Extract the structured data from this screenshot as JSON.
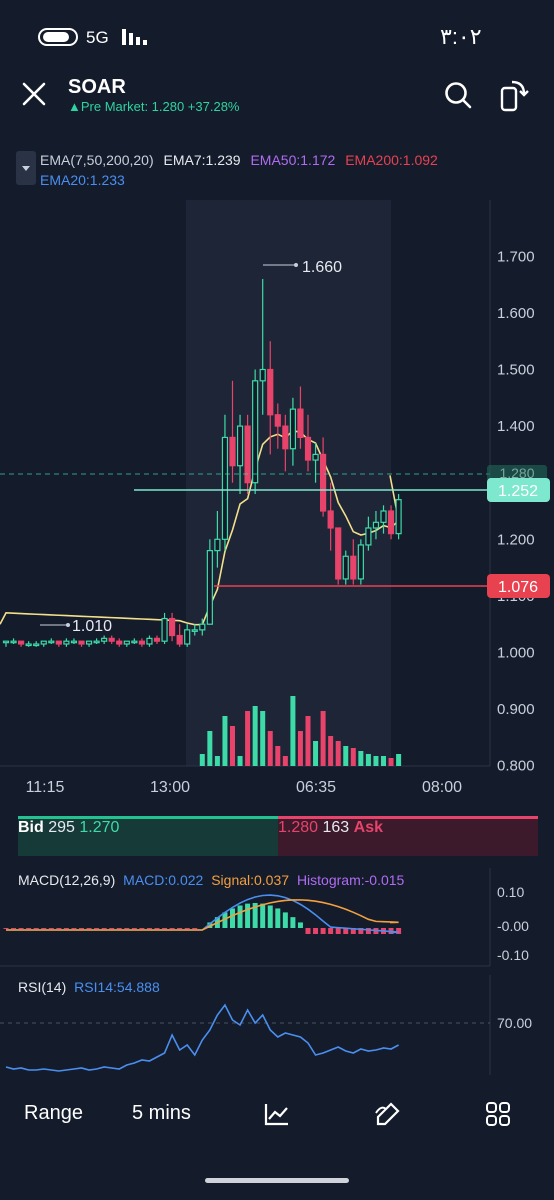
{
  "status_bar": {
    "network": "5G",
    "clock": "٣:٠٢"
  },
  "header": {
    "symbol": "SOAR",
    "pre_market": "▲Pre Market: 1.280 +37.28%"
  },
  "ema_legend": {
    "label": "EMA(7,50,200,20)",
    "ema7": "EMA7:1.239",
    "ema50": "EMA50:1.172",
    "ema200": "EMA200:1.092",
    "ema20": "EMA20:1.233"
  },
  "colors": {
    "background": "#141b2b",
    "up": "#3ddba8",
    "down": "#e8436a",
    "ema7": "#f2e08a",
    "ema50": "#b06cf2",
    "ema200": "#e84250",
    "ema20": "#4a8ff0"
  },
  "chart_data": [
    {
      "type": "candlestick",
      "y_ticks": [
        "1.700",
        "1.600",
        "1.500",
        "1.400",
        "1.300",
        "1.200",
        "1.100",
        "1.000",
        "0.900",
        "0.800"
      ],
      "ylim": [
        0.75,
        1.75
      ],
      "x_ticks": [
        "11:15",
        "13:00",
        "06:35",
        "08:00"
      ],
      "annotations": {
        "high": "1.660",
        "low": "1.010"
      },
      "price_tags": {
        "current": "1.252",
        "ema200": "1.076",
        "last_close_hidden": "1.280"
      },
      "candles": [
        [
          1.02,
          1.02,
          1.01,
          1.02
        ],
        [
          1.02,
          1.025,
          1.015,
          1.02
        ],
        [
          1.02,
          1.02,
          1.01,
          1.015
        ],
        [
          1.015,
          1.02,
          1.01,
          1.015
        ],
        [
          1.015,
          1.02,
          1.01,
          1.015
        ],
        [
          1.015,
          1.02,
          1.01,
          1.02
        ],
        [
          1.02,
          1.025,
          1.015,
          1.02
        ],
        [
          1.02,
          1.02,
          1.01,
          1.015
        ],
        [
          1.015,
          1.025,
          1.01,
          1.02
        ],
        [
          1.02,
          1.025,
          1.015,
          1.02
        ],
        [
          1.02,
          1.02,
          1.01,
          1.015
        ],
        [
          1.015,
          1.02,
          1.01,
          1.02
        ],
        [
          1.02,
          1.025,
          1.015,
          1.02
        ],
        [
          1.02,
          1.03,
          1.015,
          1.025
        ],
        [
          1.025,
          1.03,
          1.015,
          1.02
        ],
        [
          1.02,
          1.025,
          1.01,
          1.015
        ],
        [
          1.015,
          1.02,
          1.01,
          1.02
        ],
        [
          1.02,
          1.025,
          1.015,
          1.02
        ],
        [
          1.02,
          1.025,
          1.01,
          1.015
        ],
        [
          1.015,
          1.03,
          1.01,
          1.025
        ],
        [
          1.025,
          1.03,
          1.015,
          1.02
        ],
        [
          1.02,
          1.07,
          1.015,
          1.06
        ],
        [
          1.06,
          1.07,
          1.02,
          1.03
        ],
        [
          1.03,
          1.05,
          1.01,
          1.015
        ],
        [
          1.015,
          1.05,
          1.01,
          1.04
        ],
        [
          1.04,
          1.05,
          1.03,
          1.04
        ],
        [
          1.04,
          1.06,
          1.03,
          1.05
        ],
        [
          1.05,
          1.2,
          1.05,
          1.18
        ],
        [
          1.18,
          1.25,
          1.15,
          1.2
        ],
        [
          1.2,
          1.42,
          1.18,
          1.38
        ],
        [
          1.38,
          1.48,
          1.3,
          1.33
        ],
        [
          1.33,
          1.42,
          1.28,
          1.4
        ],
        [
          1.4,
          1.42,
          1.28,
          1.3
        ],
        [
          1.3,
          1.5,
          1.28,
          1.48
        ],
        [
          1.48,
          1.66,
          1.42,
          1.5
        ],
        [
          1.5,
          1.55,
          1.35,
          1.42
        ],
        [
          1.42,
          1.44,
          1.36,
          1.4
        ],
        [
          1.4,
          1.42,
          1.32,
          1.36
        ],
        [
          1.36,
          1.45,
          1.33,
          1.43
        ],
        [
          1.43,
          1.47,
          1.36,
          1.38
        ],
        [
          1.38,
          1.42,
          1.32,
          1.34
        ],
        [
          1.34,
          1.37,
          1.3,
          1.35
        ],
        [
          1.35,
          1.38,
          1.24,
          1.25
        ],
        [
          1.25,
          1.3,
          1.18,
          1.22
        ],
        [
          1.22,
          1.22,
          1.12,
          1.13
        ],
        [
          1.13,
          1.18,
          1.12,
          1.17
        ],
        [
          1.17,
          1.2,
          1.12,
          1.13
        ],
        [
          1.13,
          1.2,
          1.12,
          1.19
        ],
        [
          1.19,
          1.24,
          1.18,
          1.22
        ],
        [
          1.22,
          1.25,
          1.2,
          1.23
        ],
        [
          1.23,
          1.26,
          1.21,
          1.25
        ],
        [
          1.25,
          1.26,
          1.2,
          1.21
        ],
        [
          1.21,
          1.28,
          1.2,
          1.27
        ]
      ],
      "volumes": [
        0,
        0,
        0,
        0,
        0,
        0,
        0,
        0,
        0,
        0,
        0,
        0,
        0,
        0,
        0,
        0,
        0,
        0,
        0,
        0,
        0,
        0,
        0,
        0,
        0,
        0,
        0.12,
        0.35,
        0.1,
        0.5,
        0.4,
        0.1,
        0.55,
        0.6,
        0.55,
        0.35,
        0.2,
        0.1,
        0.7,
        0.35,
        0.5,
        0.25,
        0.55,
        0.3,
        0.25,
        0.2,
        0.18,
        0.15,
        0.12,
        0.1,
        0.1,
        0.08,
        0.12
      ]
    },
    {
      "type": "macd",
      "title": "MACD(12,26,9)",
      "macd": "MACD:0.022",
      "signal": "Signal:0.037",
      "histogram": "Histogram:-0.015",
      "y_ticks": [
        "0.10",
        "-0.00",
        "-0.10"
      ],
      "ylim": [
        -0.13,
        0.14
      ]
    },
    {
      "type": "rsi",
      "title": "RSI(14)",
      "value": "RSI14:54.888",
      "y_ticks": [
        "70.00"
      ]
    }
  ],
  "bid_ask": {
    "bid_label": "Bid",
    "bid_size": "295",
    "bid_price": "1.270",
    "ask_price": "1.280",
    "ask_size": "163",
    "ask_label": "Ask"
  },
  "bottom_bar": {
    "range": "Range",
    "interval": "5 mins"
  }
}
